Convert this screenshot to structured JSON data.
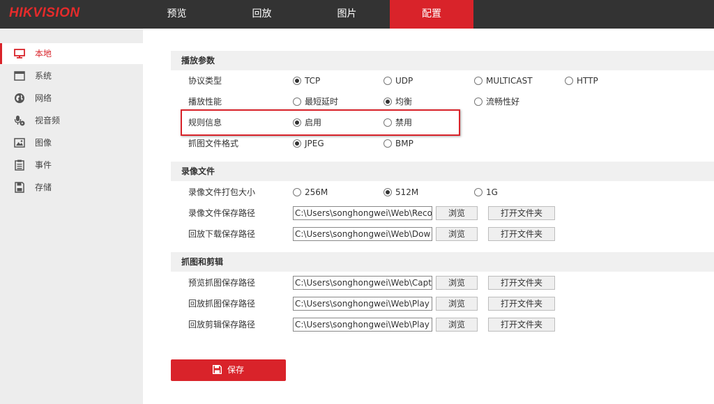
{
  "header": {
    "logo": "HIKVISION",
    "nav": [
      {
        "label": "预览"
      },
      {
        "label": "回放"
      },
      {
        "label": "图片"
      },
      {
        "label": "配置"
      }
    ],
    "active_color": "#d9232a"
  },
  "sidebar": {
    "items": [
      {
        "label": "本地",
        "icon": "monitor-icon"
      },
      {
        "label": "系统",
        "icon": "window-icon"
      },
      {
        "label": "网络",
        "icon": "globe-icon"
      },
      {
        "label": "视音频",
        "icon": "microphone-video-icon"
      },
      {
        "label": "图像",
        "icon": "image-icon"
      },
      {
        "label": "事件",
        "icon": "list-icon"
      },
      {
        "label": "存储",
        "icon": "storage-icon"
      }
    ]
  },
  "playback": {
    "title": "播放参数",
    "protocol": {
      "label": "协议类型",
      "options": [
        "TCP",
        "UDP",
        "MULTICAST",
        "HTTP"
      ],
      "selected": "TCP"
    },
    "performance": {
      "label": "播放性能",
      "options": [
        "最短延时",
        "均衡",
        "流畅性好"
      ],
      "selected": "均衡"
    },
    "rules": {
      "label": "规则信息",
      "options": [
        "启用",
        "禁用"
      ],
      "selected": "启用"
    },
    "capture_format": {
      "label": "抓图文件格式",
      "options": [
        "JPEG",
        "BMP"
      ],
      "selected": "JPEG"
    }
  },
  "record": {
    "title": "录像文件",
    "size": {
      "label": "录像文件打包大小",
      "options": [
        "256M",
        "512M",
        "1G"
      ],
      "selected": "512M"
    },
    "save_path": {
      "label": "录像文件保存路径",
      "value": "C:\\Users\\songhongwei\\Web\\Reco"
    },
    "download_path": {
      "label": "回放下载保存路径",
      "value": "C:\\Users\\songhongwei\\Web\\Dow"
    }
  },
  "capture": {
    "title": "抓图和剪辑",
    "preview_path": {
      "label": "预览抓图保存路径",
      "value": "C:\\Users\\songhongwei\\Web\\Capt"
    },
    "playback_path": {
      "label": "回放抓图保存路径",
      "value": "C:\\Users\\songhongwei\\Web\\Play"
    },
    "clip_path": {
      "label": "回放剪辑保存路径",
      "value": "C:\\Users\\songhongwei\\Web\\Play"
    }
  },
  "buttons": {
    "browse": "浏览",
    "open_folder": "打开文件夹",
    "save": "保存"
  }
}
